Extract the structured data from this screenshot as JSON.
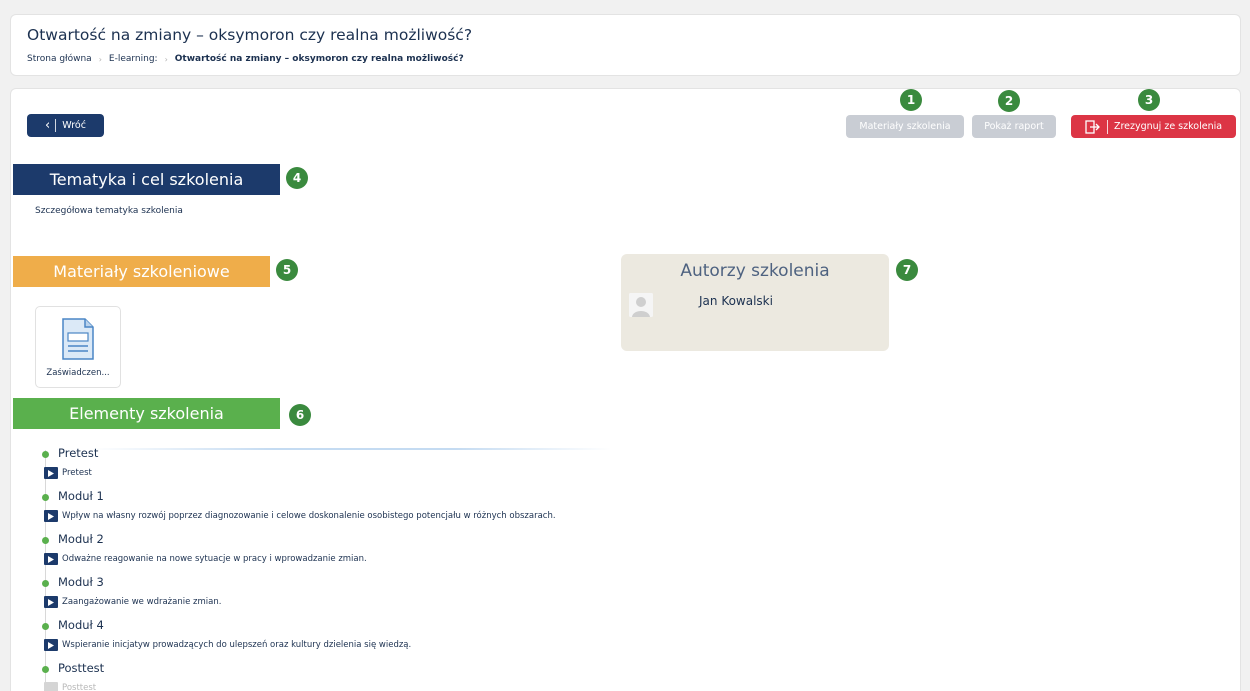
{
  "header": {
    "title": "Otwartość na zmiany – oksymoron czy realna możliwość?",
    "breadcrumb": {
      "home": "Strona główna",
      "section": "E-learning:",
      "current": "Otwartość na zmiany – oksymoron czy realna możliwość?"
    }
  },
  "toolbar": {
    "back_label": "Wróć",
    "materials_label": "Materiały szkolenia",
    "report_label": "Pokaż raport",
    "resign_label": "Zrezygnuj ze szkolenia"
  },
  "badges": {
    "b1": "1",
    "b2": "2",
    "b3": "3",
    "b4": "4",
    "b5": "5",
    "b6": "6",
    "b7": "7"
  },
  "topic": {
    "heading": "Tematyka i cel szkolenia",
    "description": "Szczegółowa tematyka szkolenia"
  },
  "materials": {
    "heading": "Materiały szkoleniowe",
    "files": [
      {
        "name": "Zaświadczen...",
        "icon": "document-icon"
      }
    ]
  },
  "authors": {
    "heading": "Autorzy szkolenia",
    "list": [
      {
        "name": "Jan Kowalski"
      }
    ]
  },
  "elements": {
    "heading": "Elementy szkolenia",
    "modules": [
      {
        "title": "Pretest",
        "item": "Pretest"
      },
      {
        "title": "Moduł 1",
        "item": "Wpływ na własny rozwój poprzez diagnozowanie i celowe doskonalenie osobistego potencjału w różnych obszarach."
      },
      {
        "title": "Moduł 2",
        "item": "Odważne reagowanie na nowe sytuacje w pracy i wprowadzanie zmian."
      },
      {
        "title": "Moduł 3",
        "item": "Zaangażowanie we wdrażanie zmian."
      },
      {
        "title": "Moduł 4",
        "item": "Wspieranie inicjatyw prowadzących do ulepszeń oraz kultury dzielenia się wiedzą."
      },
      {
        "title": "Posttest",
        "item": "Posttest"
      }
    ]
  },
  "colors": {
    "navy": "#1c3a6b",
    "orange": "#efad4a",
    "green": "#5ab04d",
    "red": "#dc3545",
    "badge_green": "#3a8a3e",
    "disabled_grey": "#c9cdd4"
  }
}
